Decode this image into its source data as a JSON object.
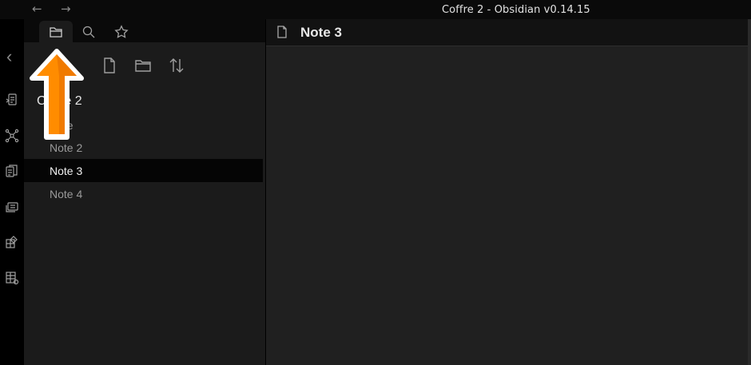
{
  "window": {
    "title": "Coffre 2 - Obsidian v0.14.15",
    "back_glyph": "←",
    "forward_glyph": "→"
  },
  "ribbon": {
    "collapse_glyph": "‹",
    "icons": [
      "open-quick-switcher-icon",
      "graph-view-icon",
      "copy-document-icon",
      "slides-icon",
      "add-block-icon",
      "table-settings-icon"
    ]
  },
  "sidebar_tabs": [
    "folder-icon",
    "search-icon",
    "star-icon"
  ],
  "file_explorer": {
    "actions": [
      "new-note-icon",
      "new-folder-icon",
      "sort-icon"
    ],
    "vault_name": "Coffre 2",
    "files": [
      {
        "label": "Note"
      },
      {
        "label": "Note 2"
      },
      {
        "label": "Note 3",
        "active": true
      },
      {
        "label": "Note 4"
      }
    ]
  },
  "editor": {
    "title": "Note 3"
  },
  "colors": {
    "accent_arrow": "#ff8c00",
    "sidebar_bg": "#1b1b1b",
    "editor_bg": "#202020"
  }
}
